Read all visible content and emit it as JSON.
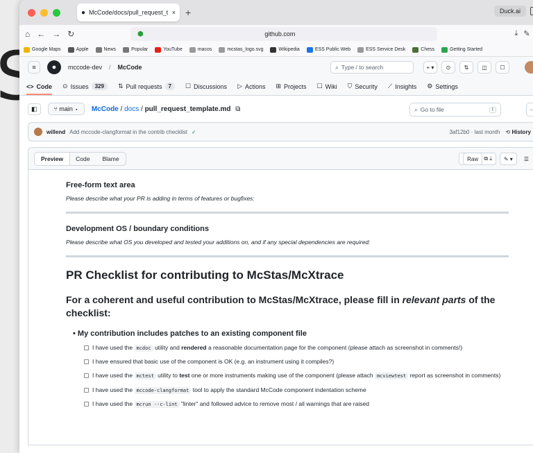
{
  "browser": {
    "tab_title": "McCode/docs/pull_request_t",
    "tab_close": "×",
    "new_tab": "+",
    "profile": "Duck.ai",
    "url_host": "github.com",
    "bookmarks": [
      {
        "label": "Google Maps",
        "color": "#f2b400"
      },
      {
        "label": " Apple",
        "color": "#555"
      },
      {
        "label": "News",
        "color": "#777"
      },
      {
        "label": "Popular",
        "color": "#777"
      },
      {
        "label": "YouTube",
        "color": "#e62117"
      },
      {
        "label": "macos",
        "color": "#999"
      },
      {
        "label": "mcstas_logo.svg",
        "color": "#999"
      },
      {
        "label": "Wikipedia",
        "color": "#333"
      },
      {
        "label": "ESS Public Web",
        "color": "#1b73e8"
      },
      {
        "label": "ESS Service Desk",
        "color": "#999"
      },
      {
        "label": "Chess",
        "color": "#4a6f37"
      },
      {
        "label": "Getting Started",
        "color": "#2da44e"
      }
    ]
  },
  "github": {
    "owner": "mccode-dev",
    "repo": "McCode",
    "search_placeholder": "Type / to search",
    "nav": [
      {
        "label": "Code",
        "icon": "<>",
        "active": true
      },
      {
        "label": "Issues",
        "icon": "⊙",
        "count": "329"
      },
      {
        "label": "Pull requests",
        "icon": "⇅",
        "count": "7"
      },
      {
        "label": "Discussions",
        "icon": "☐"
      },
      {
        "label": "Actions",
        "icon": "▷"
      },
      {
        "label": "Projects",
        "icon": "⊞"
      },
      {
        "label": "Wiki",
        "icon": "☐"
      },
      {
        "label": "Security",
        "icon": "⛉"
      },
      {
        "label": "Insights",
        "icon": "⟋"
      },
      {
        "label": "Settings",
        "icon": "⚙"
      }
    ],
    "branch": "main",
    "path_repo": "McCode",
    "path_dir": "docs",
    "path_file": "pull_request_template.md",
    "goto_placeholder": "Go to file",
    "goto_key": "t",
    "commit": {
      "author": "willend",
      "message": "Add mccode-clangformat in the contrib checklist",
      "check": "✓",
      "sha": "3af12b0 · last month",
      "history": "History"
    },
    "view_tabs": [
      "Preview",
      "Code",
      "Blame"
    ],
    "raw_label": "Raw"
  },
  "doc": {
    "s1_title": "Free-form text area",
    "s1_text": "Please describe what your PR is adding in terms of features or bugfixes:",
    "s2_title": "Development OS / boundary conditions",
    "s2_text": "Please describe what OS you developed and tested your additions on, and if any special dependencies are required:",
    "h1": "PR Checklist for contributing to McStas/McXtrace",
    "h2_pre": "For a coherent and useful contribution to McStas/McXtrace, please fill in ",
    "h2_em": "relevant parts",
    "h2_post": " of the checklist:",
    "li": "My contribution includes patches to an existing component file",
    "t1a": "I have used the ",
    "t1code": "mcdoc",
    "t1b": " utility and ",
    "t1bold": "rendered",
    "t1c": " a reasonable documentation page for the component (please attach as screenshot in comments!)",
    "t2": "I have ensured that basic use of the component is OK (e.g. an instrument using it compiles?)",
    "t3a": "I have used the ",
    "t3code": "mctest",
    "t3b": " utility to ",
    "t3bold": "test",
    "t3c": " one or more instruments making use of the component (please attach ",
    "t3code2": "mcviewtest",
    "t3d": " report as screenshot in comments)",
    "t4a": "I have used the ",
    "t4code": "mccode-clangformat",
    "t4b": " tool to apply the standard McCode component indentation scheme",
    "t5a": "I have used the ",
    "t5code": "mcrun --c-lint",
    "t5b": " \"linter\" and followed advice to remove most / all warnings that are raised"
  }
}
